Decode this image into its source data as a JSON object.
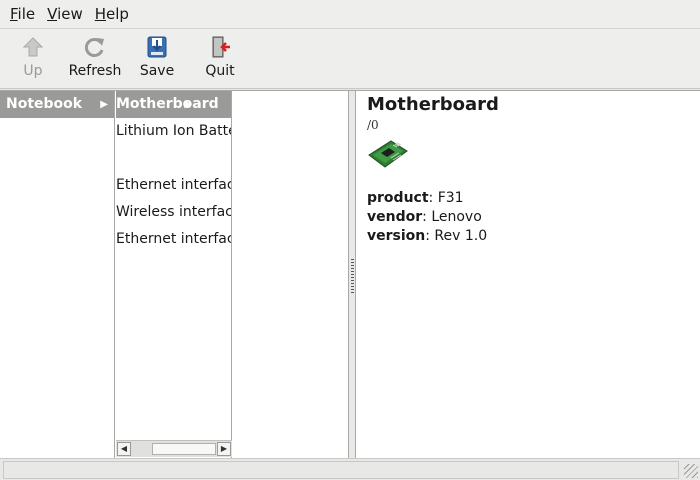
{
  "menubar": {
    "items": [
      {
        "underline": "F",
        "rest": "ile"
      },
      {
        "underline": "V",
        "rest": "iew"
      },
      {
        "underline": "H",
        "rest": "elp"
      }
    ]
  },
  "toolbar": {
    "up_label": "Up",
    "refresh_label": "Refresh",
    "save_label": "Save",
    "quit_label": "Quit"
  },
  "columns": {
    "col1": [
      {
        "label": "Notebook",
        "selected": true
      }
    ],
    "col2": [
      {
        "label": "Motherboard",
        "selected": true
      },
      {
        "label": "Lithium Ion Battery"
      },
      {
        "label": ""
      },
      {
        "label": "Ethernet interface"
      },
      {
        "label": "Wireless interface"
      },
      {
        "label": "Ethernet interface"
      }
    ]
  },
  "detail": {
    "title": "Motherboard",
    "path": "/0",
    "props": [
      {
        "key": "product",
        "value": "F31"
      },
      {
        "key": "vendor",
        "value": "Lenovo"
      },
      {
        "key": "version",
        "value": "Rev 1.0"
      }
    ]
  },
  "colors": {
    "selection": "#9a9a98",
    "pcb": "#2e7d32"
  }
}
